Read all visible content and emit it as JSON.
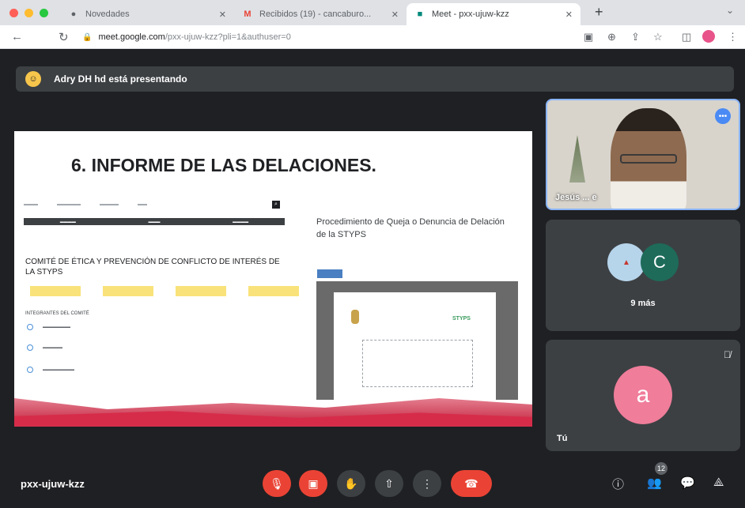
{
  "browser": {
    "tabs": [
      {
        "label": "Novedades",
        "icon": "github-icon"
      },
      {
        "label": "Recibidos (19) - cancaburo..."
      },
      {
        "label": "Meet - pxx-ujuw-kzz"
      }
    ],
    "address": {
      "host": "meet.google.com",
      "path": "/pxx-ujuw-kzz?pli=1&authuser=0"
    }
  },
  "meet": {
    "presenting_banner": "Adry DH hd está presentando",
    "slide": {
      "title": "6. INFORME DE LAS DELACIONES.",
      "committee_title": "COMITÉ DE ÉTICA Y PREVENCIÓN DE CONFLICTO DE INTERÉS DE LA STYPS",
      "members_label": "INTEGRANTES DEL COMITÉ",
      "procedure_title": "Procedimiento de Queja o Denuncia de Delación de la STYPS",
      "logo_text": "STYPS"
    },
    "participants": {
      "speaker_name": "Jesús ... e",
      "more_initial": "C",
      "more_count": "9 más",
      "self_initial": "a",
      "self_label": "Tú"
    },
    "meeting_code": "pxx-ujuw-kzz",
    "people_count": "12"
  },
  "colors": {
    "meet_background": "#1f2023",
    "tile": "#3c4043",
    "end_call_red": "#ea4335",
    "active_speaker_border": "#8ab4f8",
    "slide_wave": "#d62c4a"
  }
}
